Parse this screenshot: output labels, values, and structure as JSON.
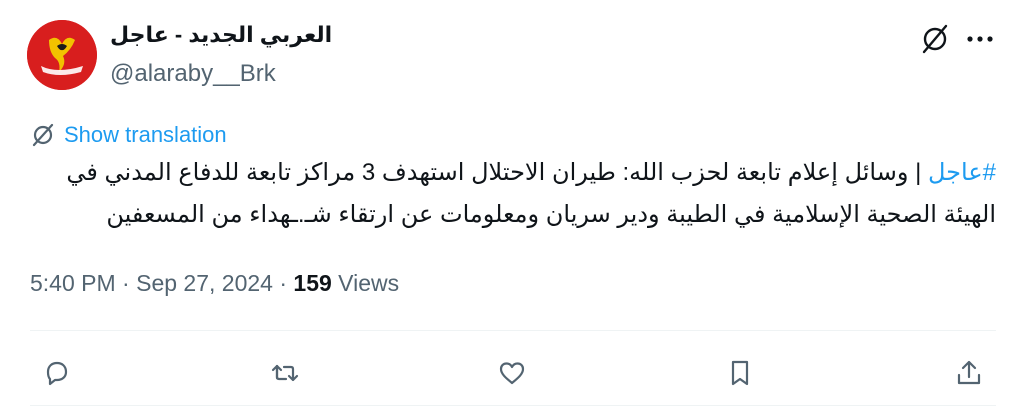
{
  "author": {
    "display_name": "العربي الجديد - عاجل",
    "handle": "@alaraby__Brk"
  },
  "show_translation_label": "Show translation",
  "tweet": {
    "hashtag": "#عاجل",
    "text": " | وسائل إعلام تابعة لحزب الله: طيران الاحتلال استهدف 3 مراكز تابعة للدفاع المدني في الهيئة الصحية الإسلامية في الطيبة ودير سريان ومعلومات عن ارتقاء شـ.ـهداء من المسعفين"
  },
  "meta": {
    "time": "5:40 PM",
    "separator": "·",
    "date": "Sep 27, 2024",
    "views_count": "159",
    "views_label": "Views"
  },
  "colors": {
    "accent": "#1d9bf0",
    "avatar_bg": "#d81e1e",
    "secondary_text": "#536471"
  },
  "icons": {
    "grok": "grok-icon",
    "more": "more-icon",
    "translate": "translate-icon",
    "reply": "reply-icon",
    "retweet": "retweet-icon",
    "like": "like-icon",
    "bookmark": "bookmark-icon",
    "share": "share-icon"
  }
}
